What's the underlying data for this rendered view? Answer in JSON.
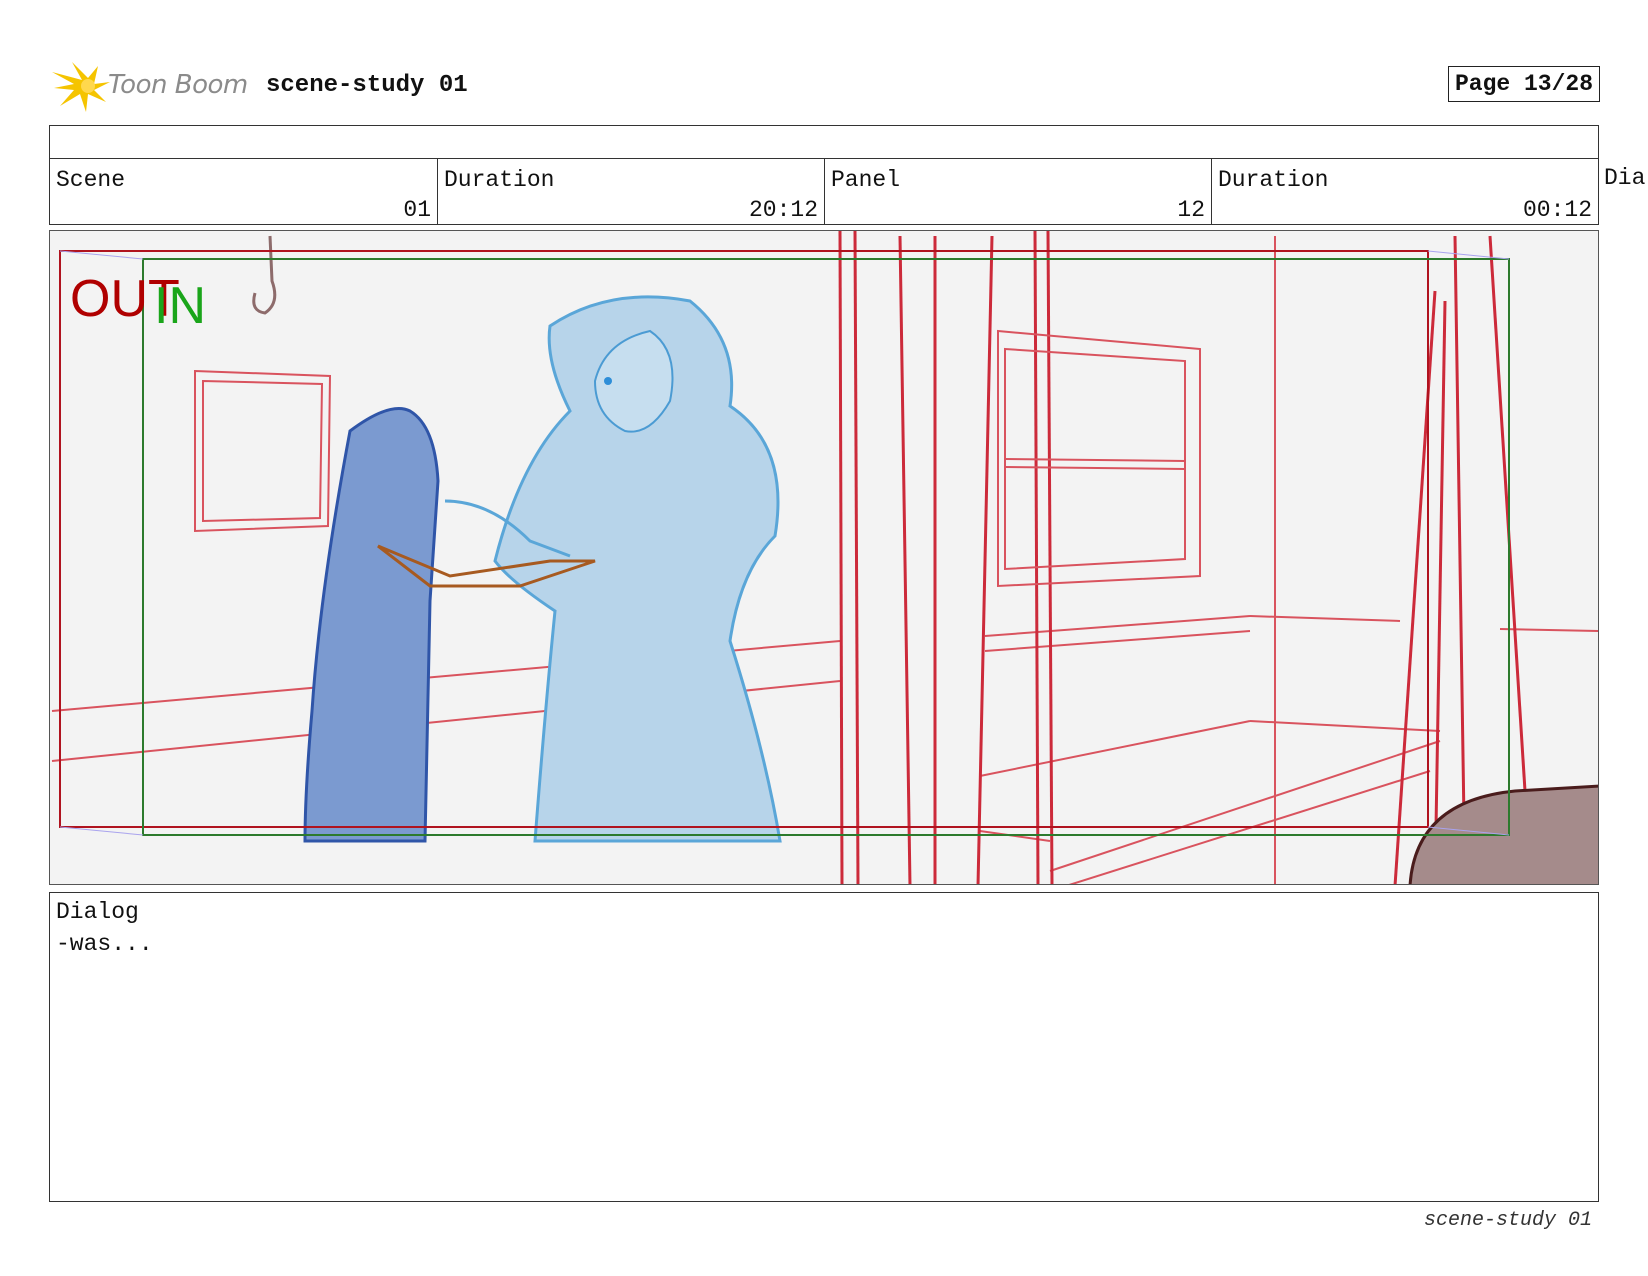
{
  "header": {
    "logo_text": "Toon Boom",
    "project_title": "scene-study 01",
    "page": "Page 13/28"
  },
  "info": {
    "scene_label": "Scene",
    "scene_value": "01",
    "scene_duration_label": "Duration",
    "scene_duration_value": "20:12",
    "panel_label": "Panel",
    "panel_value": "12",
    "panel_duration_label": "Duration",
    "panel_duration_value": "00:12",
    "overflow_label": "Dia"
  },
  "panel_overlay": {
    "out_label": "OUT",
    "in_label": "IN",
    "out_color": "#b00000",
    "in_color": "#1aa51a"
  },
  "dialog": {
    "label": "Dialog",
    "text": "-was..."
  },
  "footer": {
    "text": "scene-study 01"
  }
}
